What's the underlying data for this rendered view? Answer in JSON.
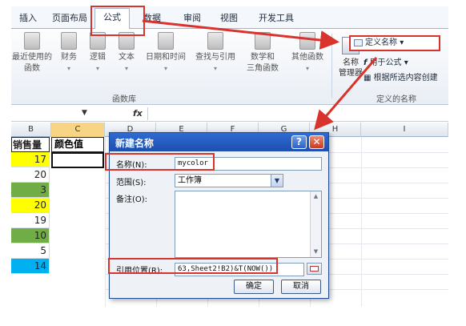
{
  "ribbon": {
    "tabs": [
      {
        "label": "插入",
        "active": false
      },
      {
        "label": "页面布局",
        "active": false
      },
      {
        "label": "公式",
        "active": true
      },
      {
        "label": "数据",
        "active": false
      },
      {
        "label": "审阅",
        "active": false
      },
      {
        "label": "视图",
        "active": false
      },
      {
        "label": "开发工具",
        "active": false
      }
    ],
    "function_library": {
      "buttons": [
        {
          "label": "最近使用的",
          "label2": "函数"
        },
        {
          "label": "财务",
          "label2": ""
        },
        {
          "label": "逻辑",
          "label2": ""
        },
        {
          "label": "文本",
          "label2": ""
        },
        {
          "label": "日期和时间",
          "label2": ""
        },
        {
          "label": "查找与引用",
          "label2": ""
        },
        {
          "label": "数学和",
          "label2": "三角函数"
        },
        {
          "label": "其他函数",
          "label2": ""
        }
      ],
      "group_label": "函数库"
    },
    "defined_names": {
      "name_manager_line1": "名称",
      "name_manager_line2": "管理器",
      "define_name": "定义名称",
      "use_in_formula": "用于公式",
      "create_from_selection": "根据所选内容创建",
      "group_label": "定义的名称"
    }
  },
  "formula_bar": {
    "fx": "fx"
  },
  "columns": {
    "b": "B",
    "c": "C",
    "d": "D",
    "e": "E",
    "f": "F",
    "g": "G",
    "h": "H",
    "i": "I"
  },
  "sheet": {
    "header_b": "销售量",
    "header_c": "颜色值",
    "rows": [
      {
        "value": "17",
        "fill": "#ffff00"
      },
      {
        "value": "20",
        "fill": "#ffffff"
      },
      {
        "value": "3",
        "fill": "#70ad47"
      },
      {
        "value": "20",
        "fill": "#ffff00"
      },
      {
        "value": "19",
        "fill": "#ffffff"
      },
      {
        "value": "10",
        "fill": "#70ad47"
      },
      {
        "value": "5",
        "fill": "#ffffff"
      },
      {
        "value": "14",
        "fill": "#00b0f0"
      }
    ]
  },
  "dialog": {
    "title": "新建名称",
    "name_label": "名称(N):",
    "name_value": "mycolor",
    "scope_label": "范围(S):",
    "scope_value": "工作簿",
    "comment_label": "备注(O):",
    "refers_to_label": "引用位置(R):",
    "refers_to_value": "63,Sheet2!B2)&T(NOW())",
    "ok": "确定",
    "cancel": "取消",
    "help_glyph": "?",
    "close_glyph": "✕"
  },
  "colors": {
    "annotation_red": "#d9332d",
    "dialog_title_blue": "#1d4fb0",
    "selected_column": "#f7d585"
  }
}
